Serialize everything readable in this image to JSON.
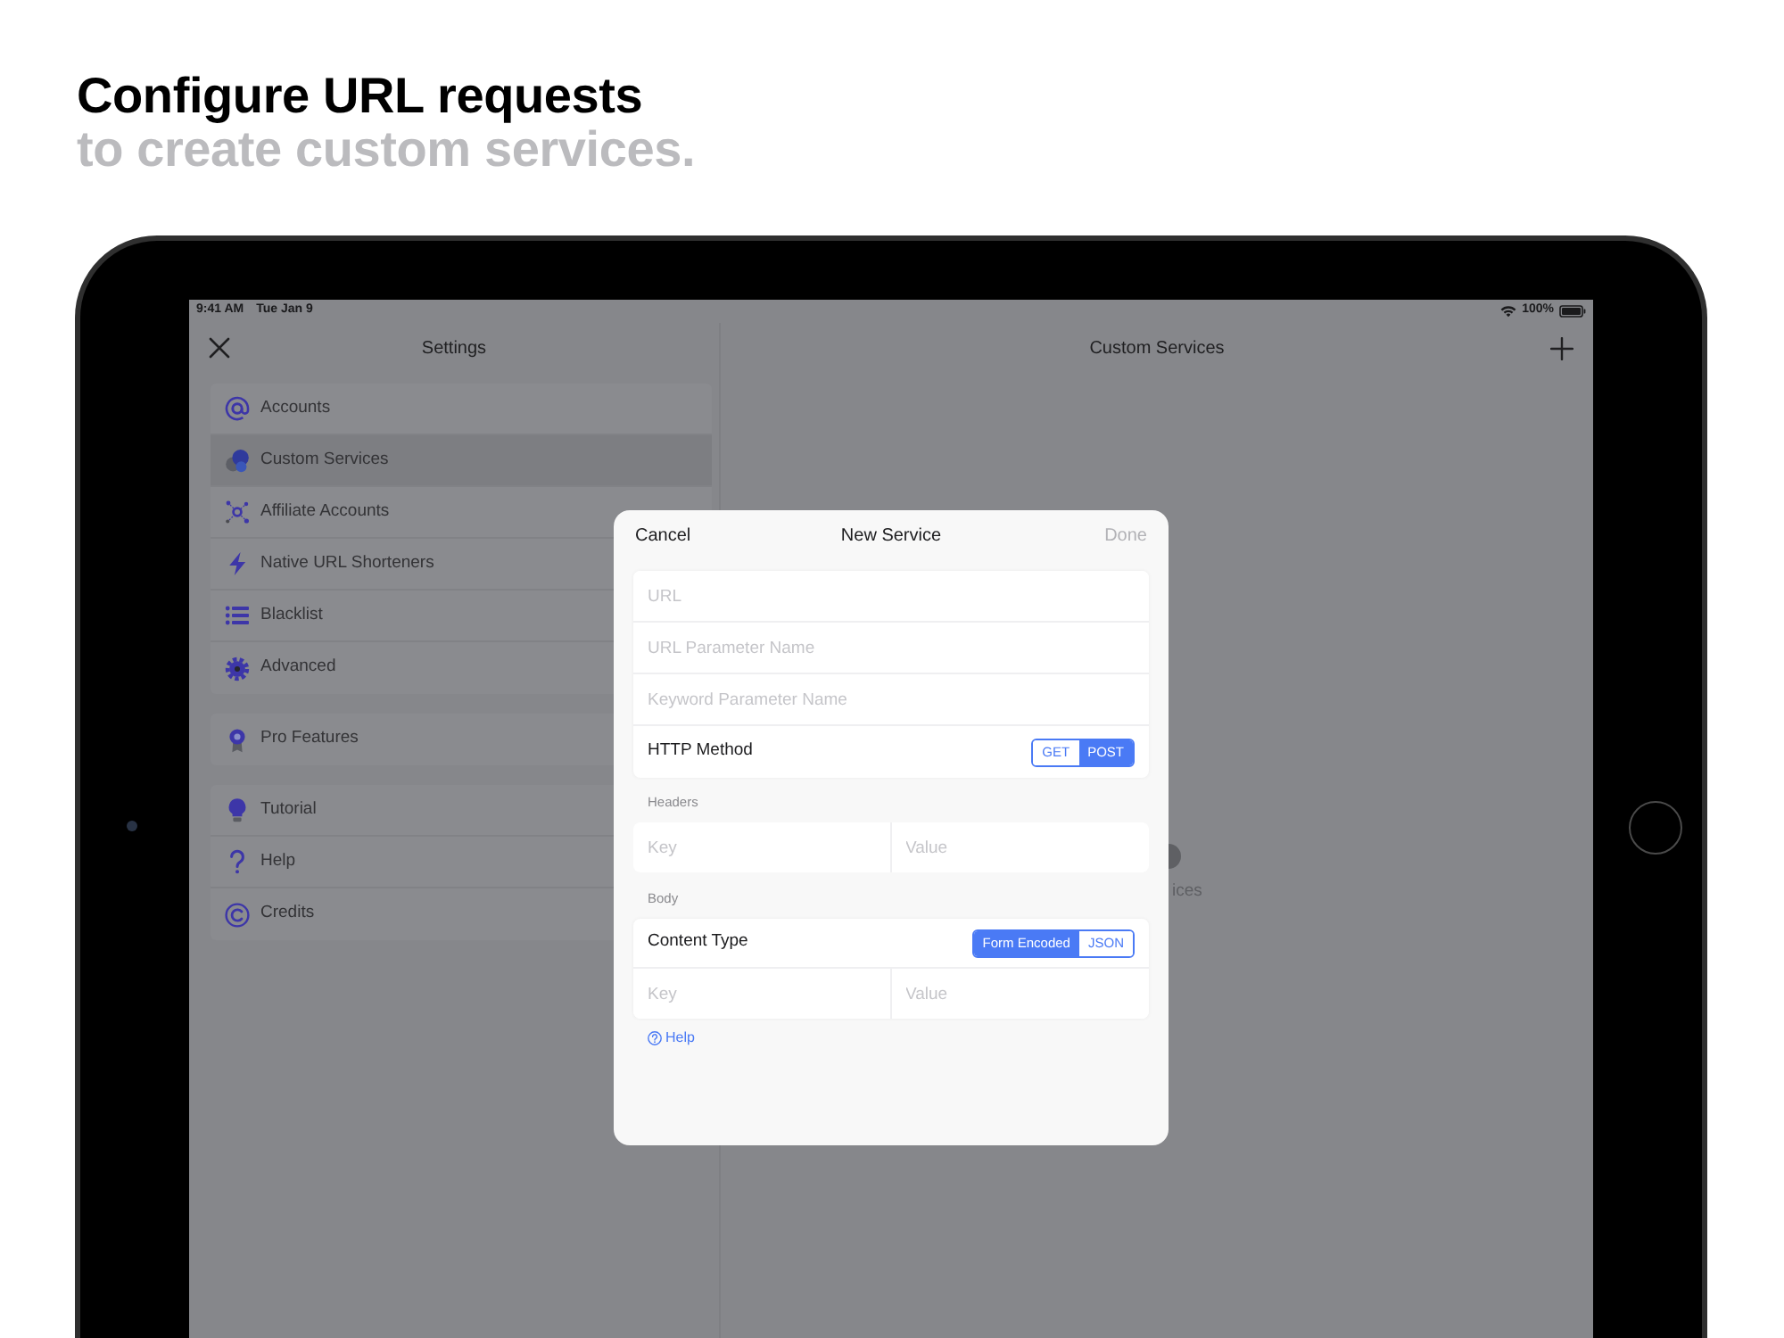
{
  "header": {
    "title": "Configure URL requests",
    "subtitle": "to create custom services."
  },
  "status_bar": {
    "time": "9:41 AM",
    "date": "Tue Jan 9",
    "battery": "100%"
  },
  "sidebar": {
    "title": "Settings",
    "groups": [
      {
        "items": [
          {
            "label": "Accounts",
            "selected": false
          },
          {
            "label": "Custom Services",
            "selected": true
          },
          {
            "label": "Affiliate Accounts",
            "selected": false
          },
          {
            "label": "Native URL Shorteners",
            "selected": false
          },
          {
            "label": "Blacklist",
            "selected": false
          },
          {
            "label": "Advanced",
            "selected": false
          }
        ]
      },
      {
        "items": [
          {
            "label": "Pro Features",
            "selected": false
          }
        ]
      },
      {
        "items": [
          {
            "label": "Tutorial",
            "selected": false
          },
          {
            "label": "Help",
            "selected": false
          },
          {
            "label": "Credits",
            "selected": false
          }
        ]
      }
    ]
  },
  "detail": {
    "title": "Custom Services",
    "partial_text": "ices"
  },
  "modal": {
    "cancel": "Cancel",
    "title": "New Service",
    "done": {
      "label": "Done",
      "disabled": true
    },
    "fields": [
      {
        "placeholder": "URL"
      },
      {
        "placeholder": "URL Parameter Name"
      },
      {
        "placeholder": "Keyword Parameter Name"
      }
    ],
    "method": {
      "label": "HTTP Method",
      "options": [
        {
          "label": "GET",
          "selected": false
        },
        {
          "label": "POST",
          "selected": true
        }
      ]
    },
    "headers": {
      "label": "Headers",
      "rows": [
        {
          "key_placeholder": "Key",
          "value_placeholder": "Value"
        }
      ]
    },
    "body": {
      "label": "Body",
      "content_type": {
        "label": "Content Type",
        "options": [
          {
            "label": "Form Encoded",
            "selected": true
          },
          {
            "label": "JSON",
            "selected": false
          }
        ]
      },
      "rows": [
        {
          "key_placeholder": "Key",
          "value_placeholder": "Value"
        }
      ]
    },
    "help_link": "Help"
  }
}
